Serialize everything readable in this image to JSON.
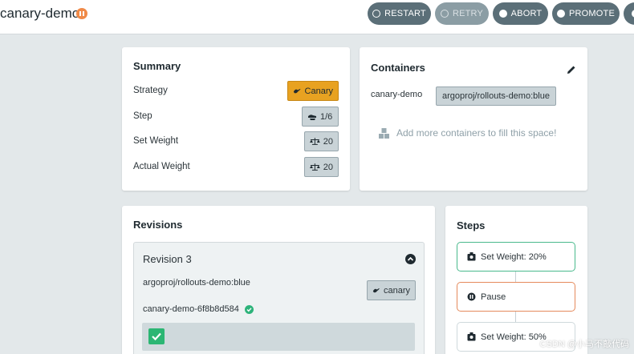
{
  "header": {
    "title": "canary-demo",
    "status_icon": "pause-icon",
    "buttons": [
      {
        "label": "RESTART",
        "icon": "restart-icon",
        "disabled": false
      },
      {
        "label": "RETRY",
        "icon": "retry-icon",
        "disabled": true
      },
      {
        "label": "ABORT",
        "icon": "abort-icon",
        "disabled": false
      },
      {
        "label": "PROMOTE",
        "icon": "promote-icon",
        "disabled": false
      }
    ]
  },
  "summary": {
    "title": "Summary",
    "rows": [
      {
        "label": "Strategy",
        "value": "Canary",
        "icon": "bird-icon"
      },
      {
        "label": "Step",
        "value": "1/6",
        "icon": "shoe-icon"
      },
      {
        "label": "Set Weight",
        "value": "20",
        "icon": "balance-scale-icon"
      },
      {
        "label": "Actual Weight",
        "value": "20",
        "icon": "balance-scale-icon"
      }
    ]
  },
  "containers": {
    "title": "Containers",
    "name": "canary-demo",
    "image": "argoproj/rollouts-demo:blue",
    "add_more_text": "Add more containers to fill this space!"
  },
  "revisions": {
    "title": "Revisions",
    "revision": {
      "title": "Revision 3",
      "image": "argoproj/rollouts-demo:blue",
      "tag": "canary",
      "replicaset": "canary-demo-6f8b8d584"
    }
  },
  "steps": {
    "title": "Steps",
    "items": [
      {
        "label": "Set Weight: 20%",
        "state": "done"
      },
      {
        "label": "Pause",
        "state": "active"
      },
      {
        "label": "Set Weight: 50%",
        "state": "pending"
      }
    ]
  },
  "watermark": "CSDN @小马不敲代码",
  "colors": {
    "accent_orange": "#e8a221",
    "success_green": "#2db37a",
    "button_gray": "#5b6f78"
  }
}
